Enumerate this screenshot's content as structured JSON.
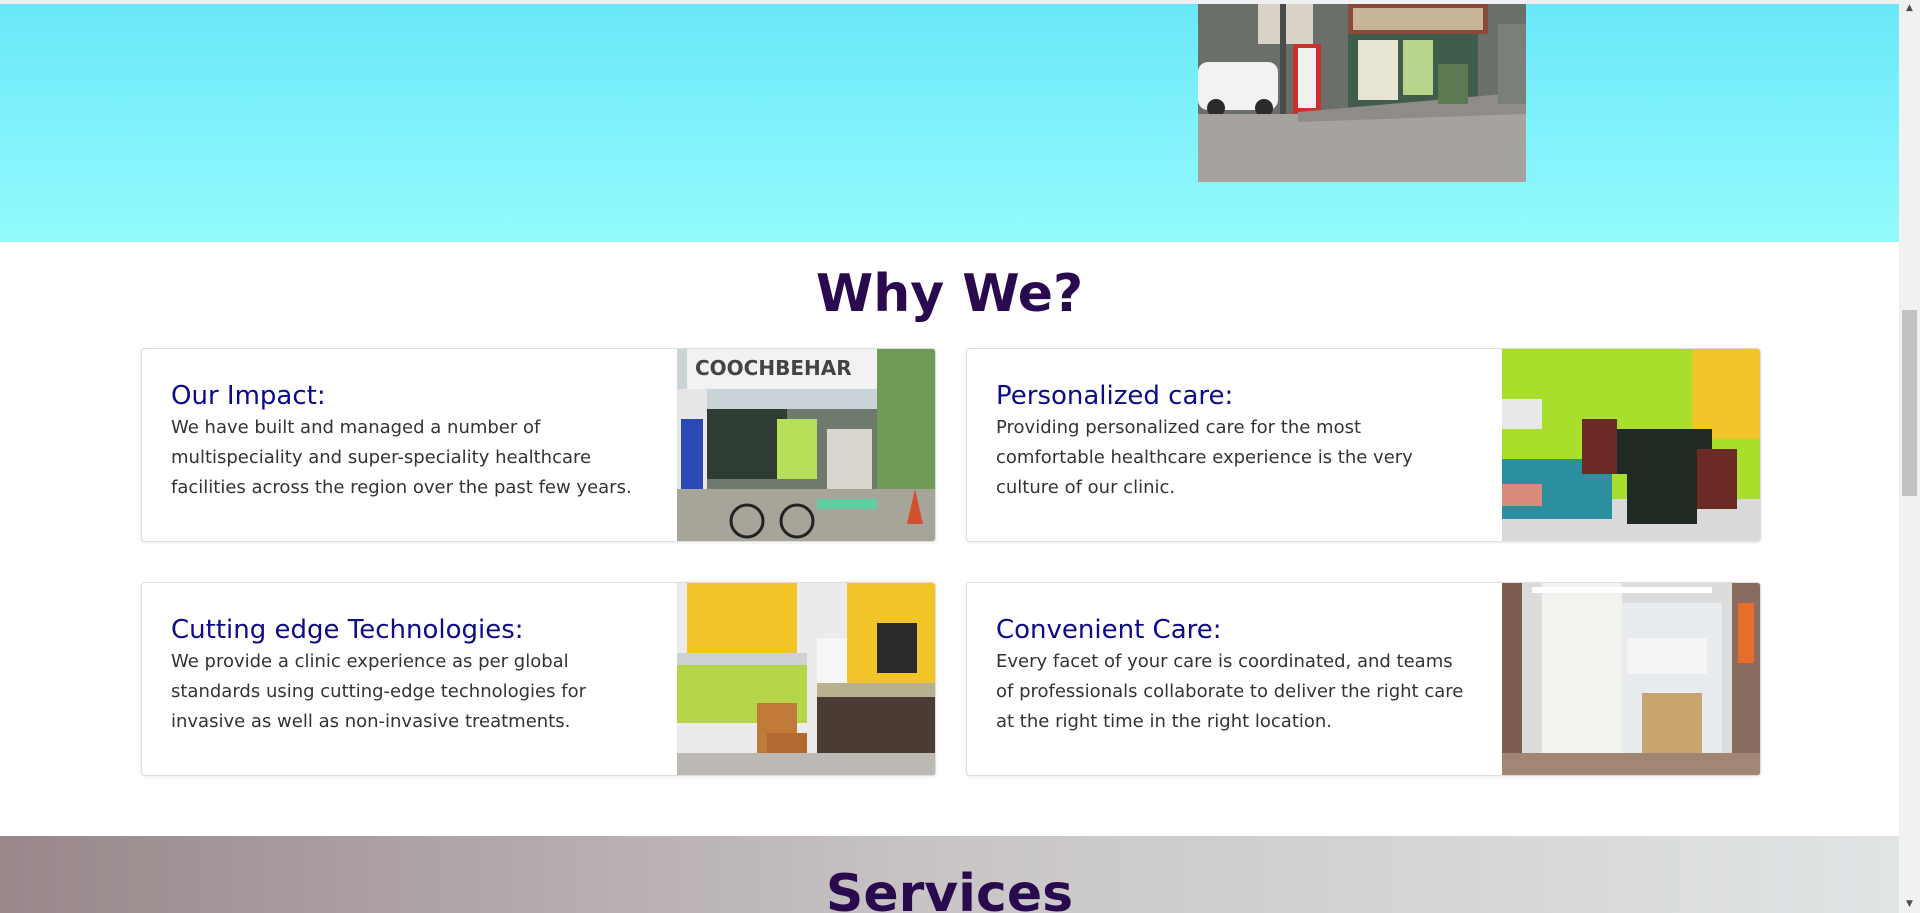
{
  "hero": {
    "photo_alt": "Coochbehar Polyclinic storefront"
  },
  "why_section": {
    "title": "Why We?",
    "cards": [
      {
        "title": "Our Impact:",
        "body": "We have built and managed a number of multispeciality and super-speciality healthcare facilities across the region over the past few years.",
        "image": "clinic-entrance-photo"
      },
      {
        "title": "Personalized care:",
        "body": "Providing personalized care for the most comfortable healthcare experience is the very culture of our clinic.",
        "image": "consultation-room-photo"
      },
      {
        "title": "Cutting edge Technologies:",
        "body": "We provide a clinic experience as per global standards using cutting-edge technologies for invasive as well as non-invasive treatments.",
        "image": "reception-desk-photo"
      },
      {
        "title": "Convenient Care:",
        "body": "Every facet of your care is coordinated, and teams of professionals collaborate to deliver the right care at the right time in the right location.",
        "image": "examination-room-photo"
      }
    ]
  },
  "services_section": {
    "title": "Services"
  },
  "colors": {
    "heading": "#2a0a4e",
    "card_title": "#0b0b8c",
    "hero_gradient_top": "#6ae8f9",
    "hero_gradient_bottom": "#93fbfd"
  }
}
